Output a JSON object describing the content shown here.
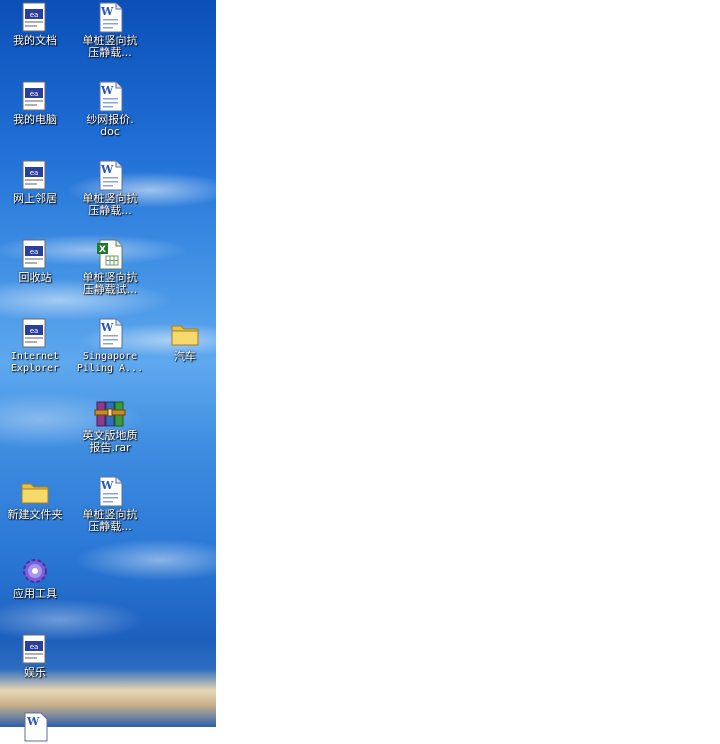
{
  "desktop": {
    "icons": [
      {
        "id": "my-documents",
        "label": "我的文档",
        "type": "app-window-icon"
      },
      {
        "id": "doc-1",
        "label": "单桩竖向抗\n压静载...",
        "type": "word-document-icon"
      },
      {
        "id": "my-computer",
        "label": "我的电脑",
        "type": "app-window-icon"
      },
      {
        "id": "doc-quote",
        "label": "纱网报价.\ndoc",
        "type": "word-document-icon"
      },
      {
        "id": "network",
        "label": "网上邻居",
        "type": "app-window-icon"
      },
      {
        "id": "doc-2",
        "label": "单桩竖向抗\n压静载...",
        "type": "word-document-icon"
      },
      {
        "id": "recycle-bin",
        "label": "回收站",
        "type": "app-window-icon"
      },
      {
        "id": "xls-1",
        "label": "单桩竖向抗\n压静载试...",
        "type": "excel-document-icon"
      },
      {
        "id": "ie",
        "label": "Internet\nExplorer",
        "type": "app-window-icon"
      },
      {
        "id": "doc-singapore",
        "label": "Singapore\nPiling A...",
        "type": "word-document-icon"
      },
      {
        "id": "folder-car",
        "label": "汽车",
        "type": "folder-icon"
      },
      {
        "id": "rar-report",
        "label": "英文版地质\n报告.rar",
        "type": "rar-archive-icon"
      },
      {
        "id": "new-folder",
        "label": "新建文件夹",
        "type": "folder-icon"
      },
      {
        "id": "doc-3",
        "label": "单桩竖向抗\n压静载...",
        "type": "word-document-icon"
      },
      {
        "id": "tools",
        "label": "应用工具",
        "type": "gear-icon"
      },
      {
        "id": "entertainment",
        "label": "娱乐",
        "type": "app-window-icon"
      },
      {
        "id": "doc-partial",
        "label": "",
        "type": "word-document-icon"
      }
    ]
  }
}
